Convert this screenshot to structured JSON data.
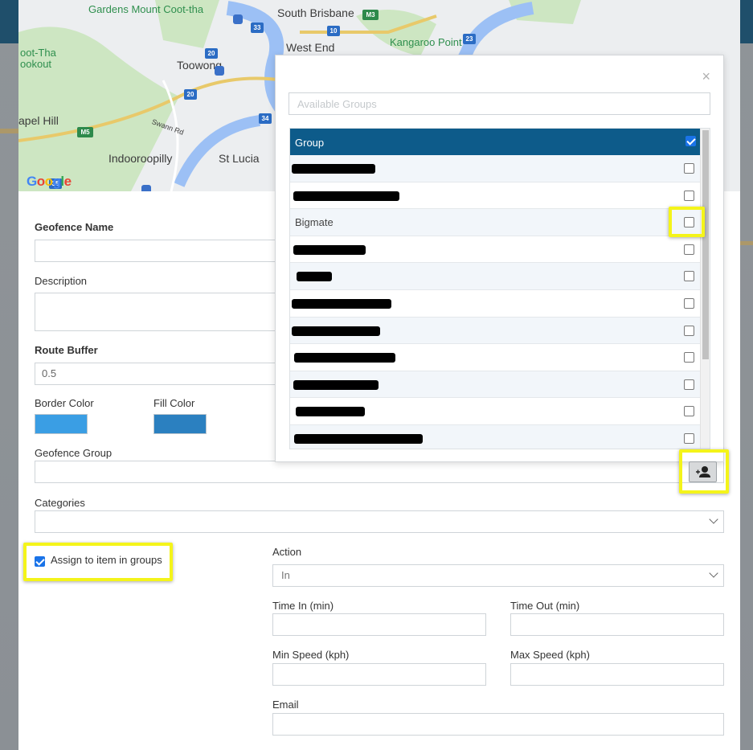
{
  "map": {
    "labels": {
      "gardens": "Gardens Mount Coot-tha",
      "south_brisbane": "South Brisbane",
      "west_end": "West End",
      "kangaroo_point": "Kangaroo Point",
      "coot_tha": "oot-Tha",
      "lookout": "ookout",
      "toowong": "Toowong",
      "chapel_hill": "apel Hill",
      "indooroopilly": "Indooroopilly",
      "st_lucia": "St Lucia",
      "swann_rd": "Swann Rd",
      "google": "Google"
    },
    "shields": {
      "r33": "33",
      "r10": "10",
      "m3": "M3",
      "r23": "23",
      "r20a": "20",
      "r20b": "20",
      "r34": "34",
      "m5": "M5",
      "r35": "35"
    }
  },
  "form": {
    "geofence_name_label": "Geofence Name",
    "description_label": "Description",
    "route_buffer_label": "Route Buffer",
    "route_buffer_value": "0.5",
    "border_color_label": "Border Color",
    "border_color": "#3a9ee4",
    "fill_color_label": "Fill Color",
    "fill_color": "#2b80c0",
    "geofence_group_label": "Geofence Group",
    "categories_label": "Categories",
    "assign_label": "Assign to item in groups",
    "assign_checked": true,
    "action_label": "Action",
    "action_value": "In",
    "time_in_label": "Time In (min)",
    "time_out_label": "Time Out (min)",
    "min_speed_label": "Min Speed (kph)",
    "max_speed_label": "Max Speed (kph)",
    "email_label": "Email"
  },
  "groups_popup": {
    "close": "×",
    "filter_placeholder": "Available Groups",
    "header": "Group",
    "header_checked": true,
    "rows": [
      {
        "name": "",
        "redacted": true,
        "checked": false
      },
      {
        "name": "",
        "redacted": true,
        "checked": false
      },
      {
        "name": "Bigmate",
        "redacted": false,
        "checked": false
      },
      {
        "name": "",
        "redacted": true,
        "checked": false
      },
      {
        "name": "",
        "redacted": true,
        "checked": false
      },
      {
        "name": "",
        "redacted": true,
        "checked": false
      },
      {
        "name": "",
        "redacted": true,
        "checked": false
      },
      {
        "name": "",
        "redacted": true,
        "checked": false
      },
      {
        "name": "",
        "redacted": true,
        "checked": false
      },
      {
        "name": "",
        "redacted": true,
        "checked": false
      },
      {
        "name": "",
        "redacted": true,
        "checked": false
      }
    ]
  },
  "colors": {
    "accent": "#0d5b8a",
    "highlight": "#f4f41a"
  }
}
